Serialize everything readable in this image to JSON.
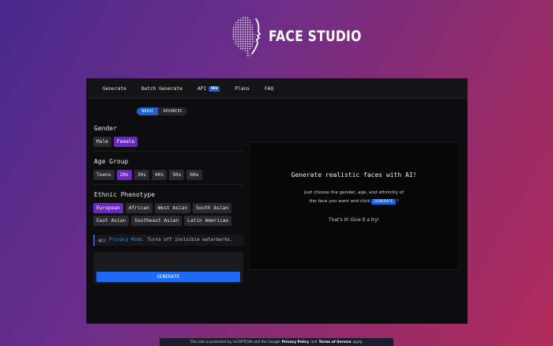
{
  "brand": {
    "name": "FACE STUDIO"
  },
  "nav": {
    "items": [
      {
        "label": "Generate"
      },
      {
        "label": "Batch Generate"
      },
      {
        "label": "API",
        "badge": "NEW"
      },
      {
        "label": "Plans"
      },
      {
        "label": "FAQ"
      }
    ]
  },
  "mode": {
    "basic": "BASIC",
    "advanced": "ADVANCED",
    "selected": "BASIC"
  },
  "gender": {
    "title": "Gender",
    "options": [
      "Male",
      "Female"
    ],
    "selected": "Female"
  },
  "age": {
    "title": "Age Group",
    "options": [
      "Teens",
      "20s",
      "30s",
      "40s",
      "50s",
      "60s"
    ],
    "selected": "20s"
  },
  "ethnic": {
    "title": "Ethnic Phenotype",
    "options": [
      "European",
      "African",
      "West Asian",
      "South Asian",
      "East Asian",
      "Southeast Asian",
      "Latin American"
    ],
    "selected": "European"
  },
  "privacy": {
    "label": "Privacy Mode.",
    "text": "Turns off invisible watermarks.",
    "enabled": false
  },
  "generate_button": "GENERATE",
  "preview": {
    "heading": "Generate realistic faces with AI!",
    "line1": "Just choose the gender, age, and ethnicity of",
    "line2_pre": "the face you want and click",
    "line2_btn": "GENERATE",
    "line2_post": "!",
    "footer": "That's it! Give it a try!"
  },
  "footer": {
    "pre": "This site is protected by reCAPTCHA and the Google",
    "privacy": "Privacy Policy",
    "and": "and",
    "terms": "Terms of Service",
    "post": "apply."
  },
  "colors": {
    "accent_blue": "#1e63d6",
    "accent_purple": "#6b26c6",
    "panel_bg": "#0d0d0f"
  },
  "icons": {
    "logo": "globe-face-logo-icon",
    "privacy_toggle": "toggle-switch-icon"
  }
}
